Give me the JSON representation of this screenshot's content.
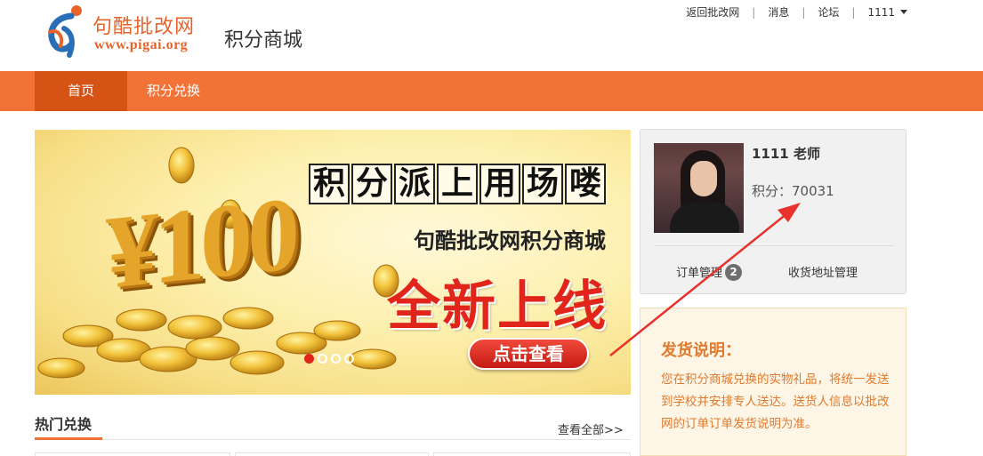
{
  "header": {
    "logo_cn": "句酷批改网",
    "logo_en": "www.pigai.org",
    "section_title": "积分商城",
    "toplinks": [
      "返回批改网",
      "消息",
      "论坛"
    ],
    "user_menu": "1111"
  },
  "nav": {
    "items": [
      {
        "label": "首页",
        "active": true
      },
      {
        "label": "积分兑换",
        "active": false
      }
    ],
    "color": "#f37236",
    "active_color": "#d55314"
  },
  "banner": {
    "slogan_chars": [
      "积",
      "分",
      "派",
      "上",
      "用",
      "场",
      "喽"
    ],
    "big_number": "¥100",
    "subtitle": "句酷批改网积分商城",
    "headline": "全新上线",
    "cta": "点击查看",
    "slides": 4,
    "active_slide": 1
  },
  "hot": {
    "title": "热门兑换",
    "view_all": "查看全部>>"
  },
  "user": {
    "name": "1111 老师",
    "points_label": "积分：70031",
    "order_link": "订单管理",
    "order_badge": "2",
    "address_link": "收货地址管理"
  },
  "shipping": {
    "title": "发货说明：",
    "text": "您在积分商城兑换的实物礼品，将统一发送到学校并安排专人送达。送货人信息以批改网的订单订单发货说明为准。"
  },
  "colors": {
    "accent": "#f37236",
    "annotation_arrow": "#e8322b"
  }
}
